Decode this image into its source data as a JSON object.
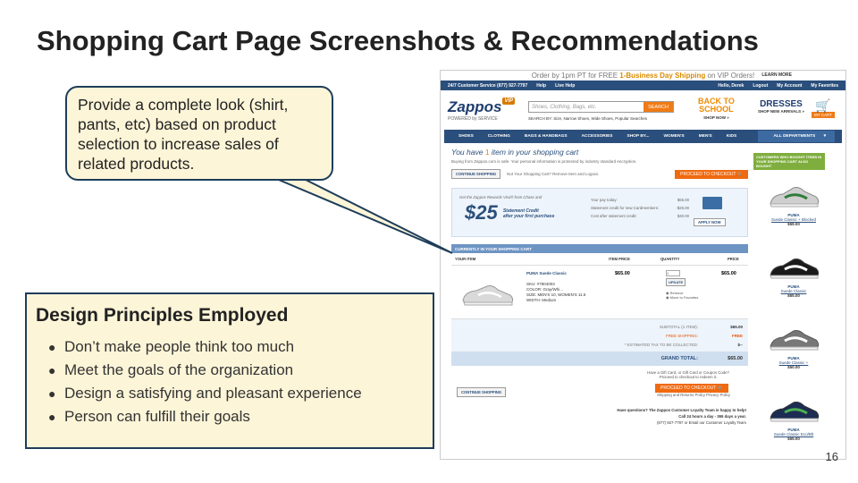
{
  "slide": {
    "title": "Shopping Cart Page Screenshots & Recommendations",
    "page_number": "16"
  },
  "callout": {
    "text": "Provide a complete look (shirt, pants, etc) based on product selection to increase sales of related products."
  },
  "principles": {
    "heading": "Design Principles Employed",
    "items": [
      "Don’t make people think too much",
      "Meet the goals of the organization",
      "Design a satisfying and pleasant experience",
      "Person can fulfill their goals"
    ]
  },
  "site": {
    "promo_prefix": "Order by 1pm PT for FREE ",
    "promo_bold": "1-Business Day Shipping",
    "promo_suffix": " on VIP Orders!",
    "learn_more": "LEARN MORE",
    "topbar": {
      "service": "24/7 Customer Service (877) 927-7797",
      "help": "Help",
      "live_help": "Live Help",
      "hello": "Hello, Derek",
      "logout": "Logout",
      "account": "My Account",
      "favorites": "My Favorites"
    },
    "logo": "Zappos",
    "logo_badge": "VIP",
    "logo_tagline": "POWERED by SERVICE",
    "search_placeholder": "Shoes, Clothing, Bags, etc.",
    "search_button": "SEARCH",
    "search_by": "SEARCH BY: Size, Narrow Shoes, Wide Shoes, Popular Searches",
    "bts_line1": "BACK TO",
    "bts_line2": "SCHOOL",
    "bts_sub": "SHOP NOW »",
    "dresses": "DRESSES",
    "dresses_sub": "SHOP NEW ARRIVALS »",
    "my_cart": "MY CART",
    "nav": [
      "SHOES",
      "CLOTHING",
      "BAGS & HANDBAGS",
      "ACCESSORIES",
      "SHOP BY...",
      "WOMEN'S",
      "MEN'S",
      "KIDS"
    ],
    "nav_all": "ALL DEPARTMENTS",
    "cart_title_prefix": "You have ",
    "cart_count": "1",
    "cart_title_suffix": " item in your shopping cart",
    "cart_note": "Buying from Zappos.com is safe. Your personal information is protected by industry standard encryption.",
    "continue_shopping": "CONTINUE SHOPPING",
    "not_your_cart": "Not Your Shopping Cart? Remove Item and Logout.",
    "proceed_checkout": "PROCEED TO CHECKOUT",
    "rewards": {
      "headline": "Get the Zappos Rewards Visa® from Chase and",
      "get_a": "Get a",
      "amount": "$25",
      "statement": "Statement Credit",
      "after": "after your first purchase",
      "lines": [
        {
          "label": "Your pay today:",
          "value": "$65.00"
        },
        {
          "label": "Statement credit for new Cardmembers:",
          "value": "-$25.00"
        },
        {
          "label": "Cost after statement credit:",
          "value": "$40.00"
        }
      ],
      "apply": "APPLY NOW"
    },
    "cart_header": "CURRENTLY IN YOUR SHOPPING CART",
    "columns": [
      "YOUR ITEM",
      "ITEM PRICE",
      "QUANTITY",
      "PRICE"
    ],
    "item": {
      "name": "PUMA Suede Classic",
      "sku": "SKU: #7804003",
      "color": "COLOR: Gray/Whi...",
      "size": "SIZE: MEN'S 10, WOMEN'S 11.5",
      "width": "WIDTH: Medium",
      "price": "$65.00",
      "qty": "1",
      "update": "UPDATE",
      "remove": "Remove",
      "move": "Move to Favorites",
      "total": "$65.00"
    },
    "totals": [
      {
        "label": "SUBTOTAL (1 ITEM):",
        "value": "$65.00"
      },
      {
        "label": "FREE SHIPPING:",
        "value": "FREE"
      },
      {
        "label": "* ESTIMATED TAX TO BE COLLECTED:",
        "value": "$--"
      }
    ],
    "grand_label": "GRAND TOTAL:",
    "grand_value": "$65.00",
    "gift_line1": "Have a Gift Card, or Gift Card or Coupon Code?",
    "gift_line2": "Proceed to checkout to redeem it.",
    "shipping_policy": "Shipping and Returns Policy   Privacy Policy",
    "questions": "Have questions? The Zappos Customer Loyalty Team is happy to help!",
    "call": "Call 24 hours a day - 365 days a year.",
    "phone": "(877) 927-7797 or Email our Customer Loyalty Team",
    "side_tag": "CUSTOMERS WHO BOUGHT ITEMS IN YOUR SHOPPING CART ALSO BOUGHT",
    "recs": [
      {
        "brand": "PUMA",
        "name": "Suede Classic + Blocked",
        "price": "$59.00",
        "color": "#2e7d3a"
      },
      {
        "brand": "PUMA",
        "name": "Suede Classic",
        "price": "$65.00",
        "color": "#1a1a1a"
      },
      {
        "brand": "PUMA",
        "name": "Suede Classic +",
        "price": "$50.00",
        "color": "#777777"
      },
      {
        "brand": "PUMA",
        "name": "Suede Classic Eco/Blt",
        "price": "$65.00",
        "color": "#1c2c52"
      }
    ]
  }
}
